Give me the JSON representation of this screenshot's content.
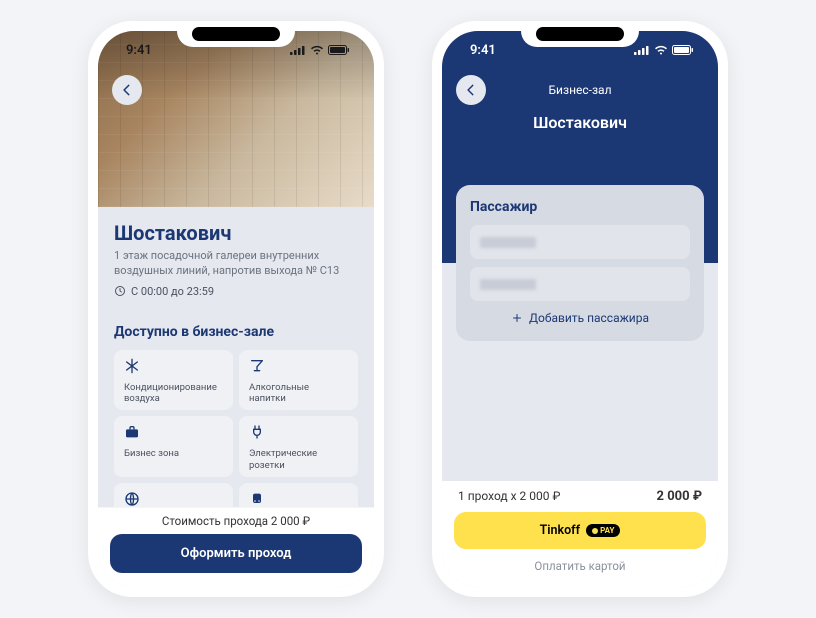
{
  "status": {
    "time": "9:41"
  },
  "phone1": {
    "title": "Шостакович",
    "subtitle": "1 этаж посадочной галереи внутренних воздушных линий, напротив выхода № С13",
    "hours": "С 00:00 до 23:59",
    "section_title": "Доступно в бизнес-зале",
    "amenities": [
      {
        "name": "snowflake-icon",
        "label": "Кондиционирование воздуха"
      },
      {
        "name": "cocktail-icon",
        "label": "Алкогольные напитки"
      },
      {
        "name": "briefcase-icon",
        "label": "Бизнес зона"
      },
      {
        "name": "plug-icon",
        "label": "Электрические розетки"
      },
      {
        "name": "globe-icon",
        "label": ""
      },
      {
        "name": "train-icon",
        "label": ""
      }
    ],
    "price_line": "Стоимость прохода 2 000 ₽",
    "cta": "Оформить проход"
  },
  "phone2": {
    "header_label": "Бизнес-зал",
    "header_title": "Шостакович",
    "card_title": "Пассажир",
    "add_pax": "Добавить пассажира",
    "summary_left": "1 проход x 2 000 ₽",
    "summary_total": "2 000 ₽",
    "tinkoff_label": "Tinkoff",
    "tinkoff_badge": "PAY",
    "pay_card": "Оплатить картой"
  }
}
